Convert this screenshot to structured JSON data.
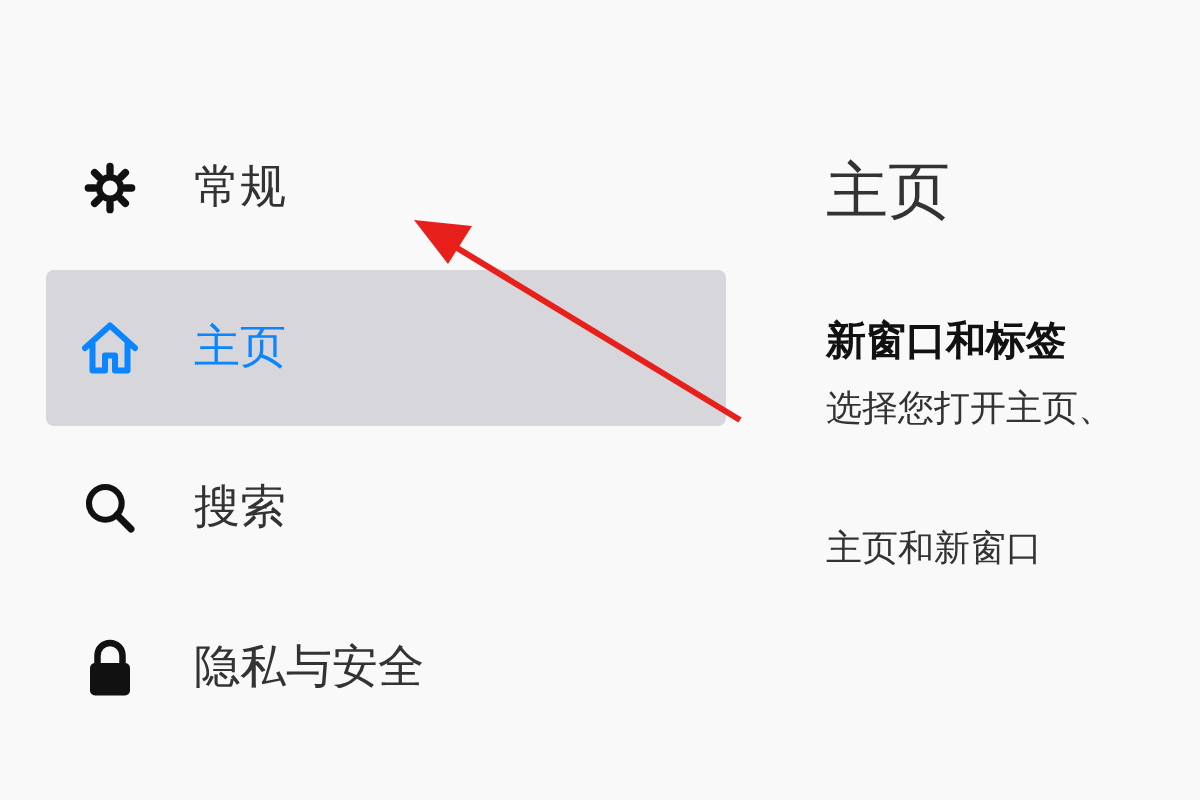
{
  "sidebar": {
    "items": [
      {
        "label": "常规",
        "selected": false
      },
      {
        "label": "主页",
        "selected": true
      },
      {
        "label": "搜索",
        "selected": false
      },
      {
        "label": "隐私与安全",
        "selected": false
      }
    ]
  },
  "content": {
    "title": "主页",
    "section_heading": "新窗口和标签",
    "section_description": "选择您打开主页、",
    "subsection_label": "主页和新窗口"
  }
}
